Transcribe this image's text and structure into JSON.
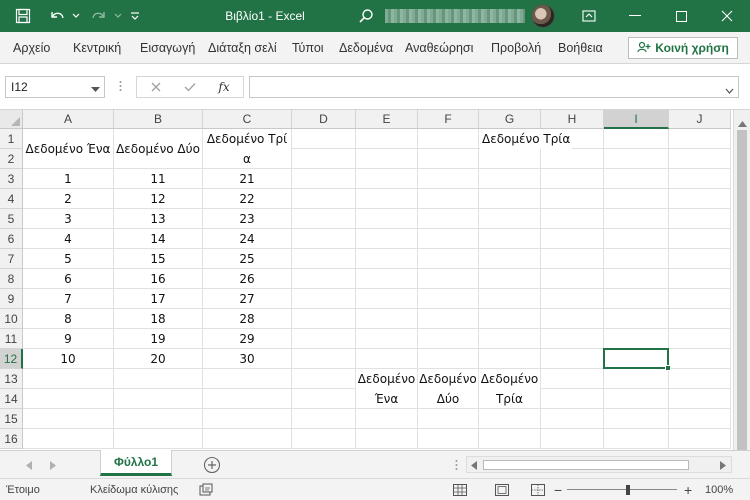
{
  "window": {
    "title": "Βιβλίο1 - Excel",
    "accent": "#217346"
  },
  "ribbon": {
    "tabs": [
      "Αρχείο",
      "Κεντρική",
      "Εισαγωγή",
      "Διάταξη σελί",
      "Τύποι",
      "Δεδομένα",
      "Αναθεώρησι",
      "Προβολή",
      "Βοήθεια"
    ],
    "share_label": "Κοινή χρήση"
  },
  "formula_bar": {
    "name_box": "I12",
    "fx_label": "fx",
    "content": ""
  },
  "sheet": {
    "columns": [
      "A",
      "B",
      "C",
      "D",
      "E",
      "F",
      "G",
      "H",
      "I",
      "J"
    ],
    "rows": [
      "1",
      "2",
      "3",
      "4",
      "5",
      "6",
      "7",
      "8",
      "9",
      "10",
      "11",
      "12",
      "13",
      "14",
      "15",
      "16"
    ],
    "selected_cell": "I12",
    "selected_col": "I",
    "selected_row": "12",
    "headers": {
      "A": "Δεδομένο Ένα",
      "B": "Δεδομένο Δύο",
      "C": "Δεδομένο Τρία",
      "G1": "Δεδομένο Τρία",
      "E13": "Δεδομένο Ένα",
      "F13": "Δεδομένο Δύο",
      "G13": "Δεδομένο Τρία"
    },
    "data_rows": [
      {
        "a": "1",
        "b": "11",
        "c": "21"
      },
      {
        "a": "2",
        "b": "12",
        "c": "22"
      },
      {
        "a": "3",
        "b": "13",
        "c": "23"
      },
      {
        "a": "4",
        "b": "14",
        "c": "24"
      },
      {
        "a": "5",
        "b": "15",
        "c": "25"
      },
      {
        "a": "6",
        "b": "16",
        "c": "26"
      },
      {
        "a": "7",
        "b": "17",
        "c": "27"
      },
      {
        "a": "8",
        "b": "18",
        "c": "28"
      },
      {
        "a": "9",
        "b": "19",
        "c": "29"
      },
      {
        "a": "10",
        "b": "20",
        "c": "30"
      }
    ]
  },
  "sheet_tabs": {
    "active": "Φύλλο1"
  },
  "status": {
    "ready": "Έτοιμο",
    "scroll_lock": "Κλείδωμα κύλισης",
    "zoom": "100%",
    "zoom_minus": "−",
    "zoom_plus": "+"
  }
}
